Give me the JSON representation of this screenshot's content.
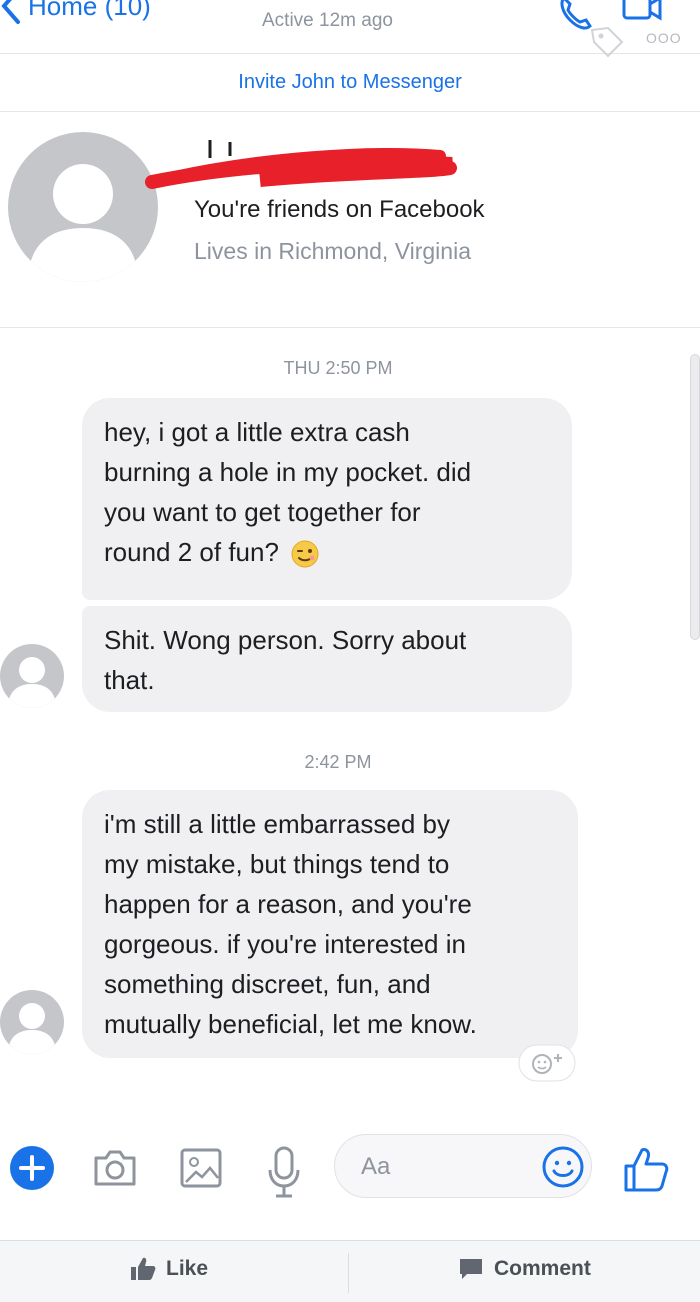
{
  "header": {
    "back_label": "Home (10)",
    "status": "Active 12m ago",
    "more_label": "OOO",
    "icons": [
      "chevron-left-icon",
      "phone-icon",
      "video-camera-icon",
      "tag-icon"
    ]
  },
  "invite": {
    "label": "Invite John to Messenger"
  },
  "profile": {
    "name_redacted": true,
    "friends_text": "You're friends on Facebook",
    "location_text": "Lives in Richmond, Virginia"
  },
  "conversation": {
    "timestamps": [
      "THU 2:50 PM",
      "2:42 PM"
    ],
    "messages": [
      {
        "lines": [
          "hey, i got a little extra cash",
          "burning a hole in my pocket. did",
          "you want to get together for",
          "round 2 of fun?"
        ],
        "emoji": "winking-face"
      },
      {
        "lines": [
          "Shit. Wong person.  Sorry about",
          "that."
        ]
      },
      {
        "lines": [
          "i'm still a little embarrassed by",
          "my mistake, but things tend to",
          "happen for a reason, and you're",
          "gorgeous.  if you're interested in",
          "something discreet, fun, and",
          "mutually beneficial, let me know."
        ]
      }
    ]
  },
  "composer": {
    "placeholder": "Aa",
    "icons": [
      "plus-icon",
      "camera-icon",
      "gallery-icon",
      "microphone-icon",
      "emoji-icon",
      "thumbs-up-icon"
    ],
    "accent_color": "#1a72e8"
  },
  "footer": {
    "like_label": "Like",
    "comment_label": "Comment"
  }
}
